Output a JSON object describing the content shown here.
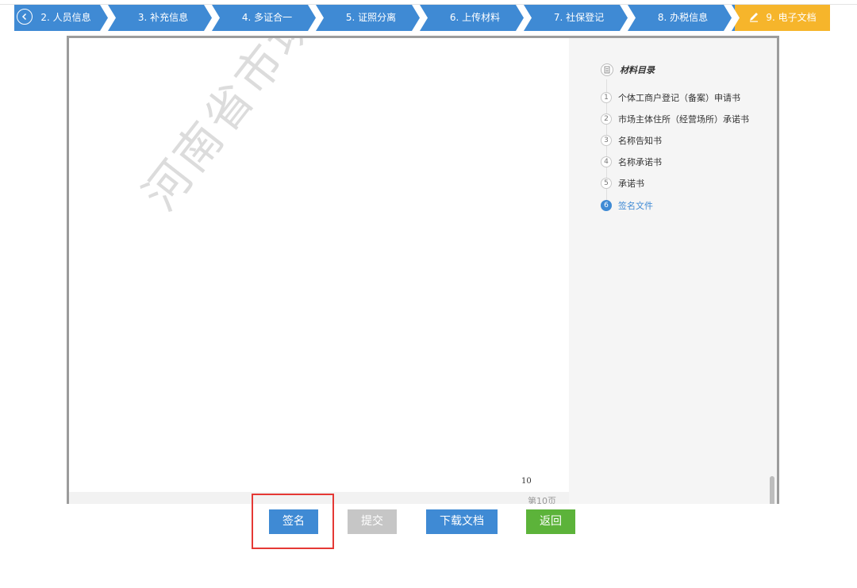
{
  "steps": [
    {
      "label": "2. 人员信息"
    },
    {
      "label": "3. 补充信息"
    },
    {
      "label": "4. 多证合一"
    },
    {
      "label": "5. 证照分离"
    },
    {
      "label": "6. 上传材料"
    },
    {
      "label": "7. 社保登记"
    },
    {
      "label": "8. 办税信息"
    },
    {
      "label": "9. 电子文档",
      "active": true
    }
  ],
  "document": {
    "watermark": "河南省市场监督管理",
    "page_number": "10",
    "page_label": "第10页"
  },
  "toc": {
    "title": "材料目录",
    "items": [
      {
        "num": "1",
        "label": "个体工商户登记（备案）申请书"
      },
      {
        "num": "2",
        "label": "市场主体住所（经营场所）承诺书"
      },
      {
        "num": "3",
        "label": "名称告知书"
      },
      {
        "num": "4",
        "label": "名称承诺书"
      },
      {
        "num": "5",
        "label": "承诺书"
      },
      {
        "num": "6",
        "label": "签名文件",
        "active": true
      }
    ]
  },
  "buttons": {
    "sign": "签名",
    "submit": "提交",
    "download": "下载文档",
    "back": "返回"
  },
  "colors": {
    "step_blue": "#3f8ad4",
    "step_active": "#f6b52b",
    "button_green": "#5cb33a",
    "button_disabled": "#c6c6c6",
    "highlight": "#e53935"
  }
}
